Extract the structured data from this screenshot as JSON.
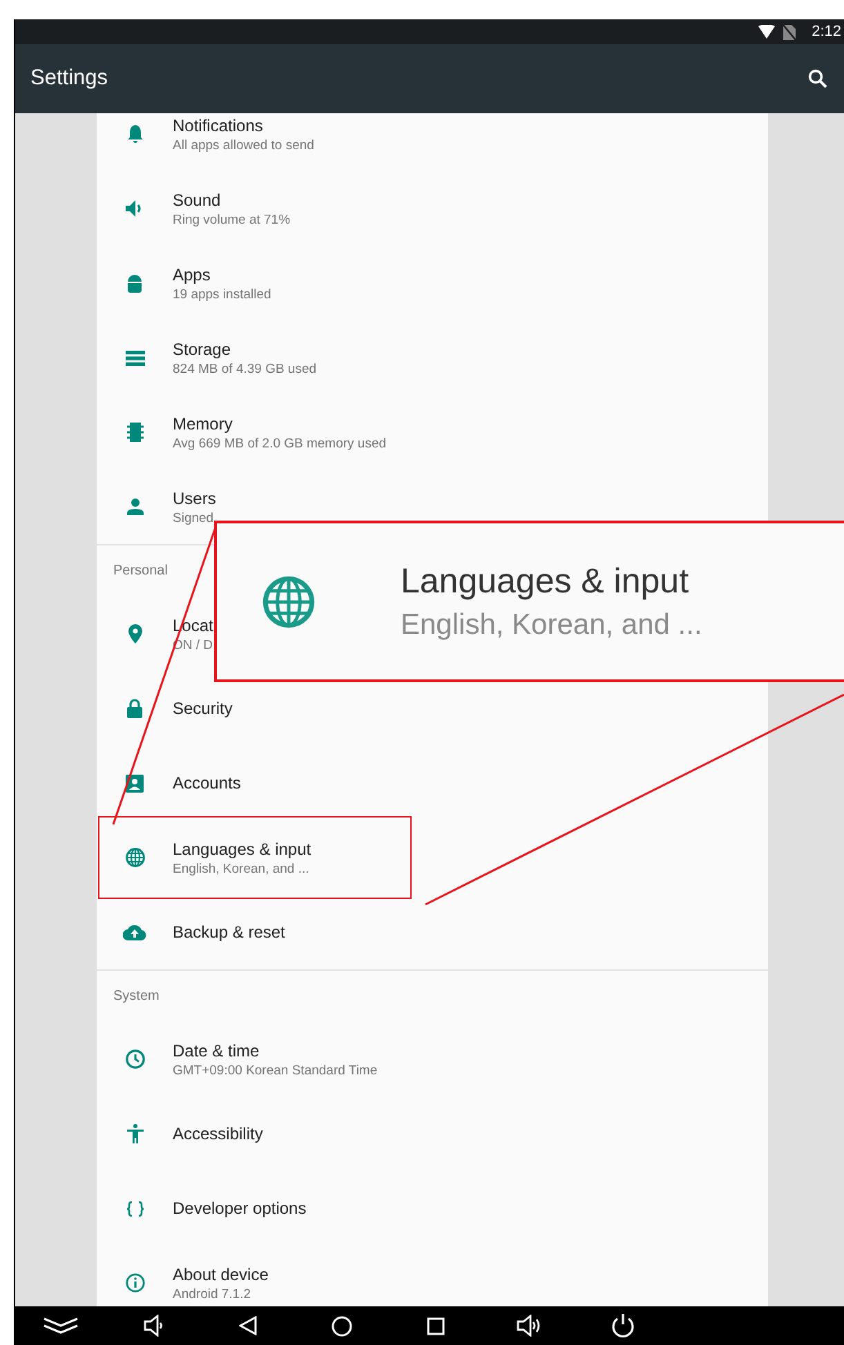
{
  "status_bar": {
    "time": "2:12"
  },
  "toolbar": {
    "title": "Settings"
  },
  "sections": [
    {
      "items": [
        {
          "title": "Notifications",
          "subtitle": "All apps allowed to send",
          "highlighted": false
        },
        {
          "title": "Sound",
          "subtitle": "Ring volume at 71%",
          "highlighted": false
        },
        {
          "title": "Apps",
          "subtitle": "19 apps installed",
          "highlighted": false
        },
        {
          "title": "Storage",
          "subtitle": "824 MB of 4.39 GB used",
          "highlighted": false
        },
        {
          "title": "Memory",
          "subtitle": "Avg 669 MB of 2.0 GB memory used",
          "highlighted": false
        },
        {
          "title": "Users",
          "subtitle": "Signed",
          "highlighted": false
        }
      ]
    },
    {
      "header": "Personal",
      "items": [
        {
          "title": "Locat",
          "subtitle": "ON / D",
          "highlighted": false
        },
        {
          "title": "Security",
          "highlighted": false
        },
        {
          "title": "Accounts",
          "highlighted": false
        },
        {
          "title": "Languages & input",
          "subtitle": "English, Korean, and ...",
          "highlighted": true
        },
        {
          "title": "Backup & reset",
          "highlighted": false
        }
      ]
    },
    {
      "header": "System",
      "items": [
        {
          "title": "Date & time",
          "subtitle": "GMT+09:00 Korean Standard Time",
          "highlighted": false
        },
        {
          "title": "Accessibility",
          "highlighted": false
        },
        {
          "title": "Developer options",
          "highlighted": false
        },
        {
          "title": "About device",
          "subtitle": "Android 7.1.2",
          "highlighted": false
        }
      ]
    }
  ],
  "callout": {
    "title": "Languages & input",
    "subtitle": "English, Korean, and ..."
  }
}
